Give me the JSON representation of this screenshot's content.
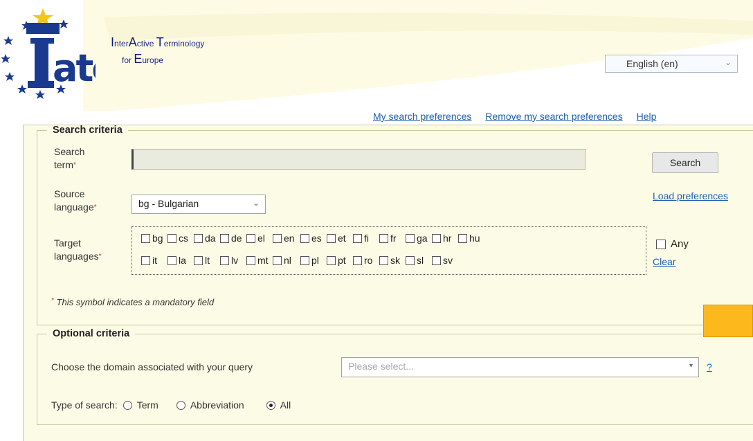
{
  "header": {
    "tagline_line1_parts": [
      "I",
      "nter",
      "A",
      "ctive ",
      "T",
      "erminology"
    ],
    "tagline_line2_parts": [
      "for ",
      "E",
      "urope"
    ],
    "language_select": "English (en)",
    "links": {
      "my_prefs": "My search preferences",
      "remove_prefs": "Remove my search preferences",
      "help": "Help"
    }
  },
  "search_criteria": {
    "legend": "Search criteria",
    "search_term_label": "Search term",
    "search_term_value": "",
    "search_button": "Search",
    "source_language_label": "Source language",
    "source_language_value": "bg - Bulgarian",
    "load_preferences": "Load preferences",
    "target_languages_label": "Target languages",
    "target_row1": [
      "bg",
      "cs",
      "da",
      "de",
      "el",
      "en",
      "es",
      "et",
      "fi",
      "fr",
      "ga",
      "hr",
      "hu"
    ],
    "target_row2": [
      "it",
      "la",
      "lt",
      "lv",
      "mt",
      "nl",
      "pl",
      "pt",
      "ro",
      "sk",
      "sl",
      "sv"
    ],
    "any_label": "Any",
    "clear_label": "Clear",
    "mandatory_note": "This symbol indicates a mandatory field",
    "required_mark": "*"
  },
  "optional_criteria": {
    "legend": "Optional criteria",
    "domain_label": "Choose the domain associated with your query",
    "domain_placeholder": "Please select...",
    "help_link": "?",
    "type_label": "Type of search:",
    "types": [
      "Term",
      "Abbreviation",
      "All"
    ],
    "selected_type": "All"
  },
  "colors": {
    "accent_orange": "#fbb91c",
    "link_blue": "#1e5eb0",
    "panel_bg": "#fbfbe6",
    "logo_blue": "#1a3a8f",
    "star_yellow": "#f5c518"
  },
  "icons": [
    "iate-logo",
    "chevron-down-icon",
    "checkbox-icon",
    "radio-icon"
  ]
}
